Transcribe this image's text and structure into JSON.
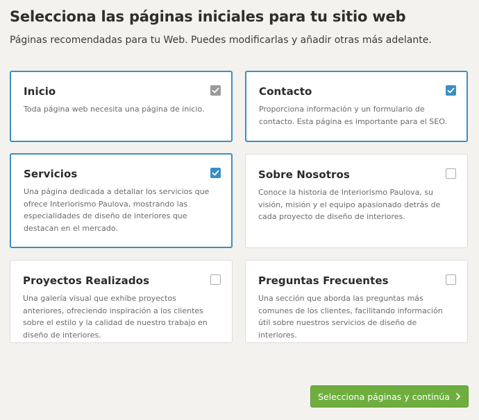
{
  "header": {
    "title": "Selecciona las páginas iniciales para tu sitio web",
    "subtitle": "Páginas recomendadas para tu Web. Puedes modificarlas y añadir otras más adelante."
  },
  "pages": [
    {
      "title": "Inicio",
      "description": "Toda página web necesita una página de inicio.",
      "checked": true,
      "locked": true
    },
    {
      "title": "Contacto",
      "description": "Proporciona información y un formulario de contacto. Esta página es importante para el SEO.",
      "checked": true,
      "locked": false
    },
    {
      "title": "Servicios",
      "description": "Una página dedicada a detallar los servicios que ofrece Interiorismo Paulova, mostrando las especialidades de diseño de interiores que destacan en el mercado.",
      "checked": true,
      "locked": false
    },
    {
      "title": "Sobre Nosotros",
      "description": "Conoce la historia de Interiorismo Paulova, su visión, misión y el equipo apasionado detrás de cada proyecto de diseño de interiores.",
      "checked": false,
      "locked": false
    },
    {
      "title": "Proyectos Realizados",
      "description": "Una galería visual que exhibe proyectos anteriores, ofreciendo inspiración a los clientes sobre el estilo y la calidad de nuestro trabajo en diseño de interiores.",
      "checked": false,
      "locked": false
    },
    {
      "title": "Preguntas Frecuentes",
      "description": "Una sección que aborda las preguntas más comunes de los clientes, facilitando información útil sobre nuestros servicios de diseño de interiores.",
      "checked": false,
      "locked": false
    }
  ],
  "footer": {
    "continue_label": "Selecciona páginas y continúa",
    "continue_icon": "chevron-right-icon"
  },
  "colors": {
    "selected_border": "#3a8fc4",
    "check_blue": "#3a8fc4",
    "check_locked": "#9a9a9a",
    "cta_green": "#6fae3e",
    "background": "#f4f2ee"
  }
}
